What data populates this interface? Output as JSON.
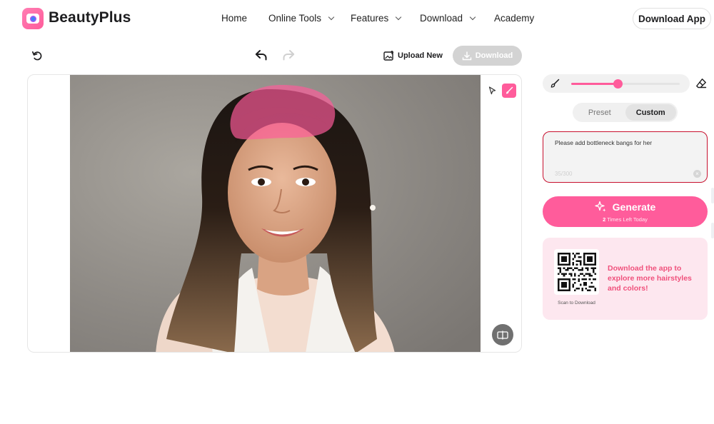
{
  "header": {
    "brand": "BeautyPlus",
    "nav": [
      {
        "label": "Home",
        "has_dropdown": false
      },
      {
        "label": "Online Tools",
        "has_dropdown": true
      },
      {
        "label": "Features",
        "has_dropdown": true
      },
      {
        "label": "Download",
        "has_dropdown": true
      },
      {
        "label": "Academy",
        "has_dropdown": false
      }
    ],
    "download_app": "Download App"
  },
  "toolbar": {
    "upload_new": "Upload New",
    "download": "Download",
    "icons": [
      "reset-icon",
      "undo-icon",
      "redo-icon",
      "upload-image-icon",
      "download-icon"
    ]
  },
  "canvas": {
    "tools": [
      "select-arrow-icon",
      "brush-icon"
    ],
    "active_tool": "brush-icon",
    "compare_icon": "compare-icon"
  },
  "panel": {
    "brush_size_fraction": 0.43,
    "tabs": [
      "Preset",
      "Custom"
    ],
    "active_tab": "Custom",
    "prompt_text": "Please add bottleneck bangs for her",
    "char_count": "35/300",
    "generate": "Generate",
    "times_left_count": "2",
    "times_left_text": " Times Left Today",
    "scan_caption": "Scan to Download",
    "promo_text": "Download the app to explore more hairstyles and colors!"
  },
  "colors": {
    "accent": "#ff5c9b",
    "promo_text": "#f0517c",
    "promo_bg": "#fde7ef",
    "highlight_border": "#c8102e",
    "download_disabled": "#d3d3d3"
  }
}
